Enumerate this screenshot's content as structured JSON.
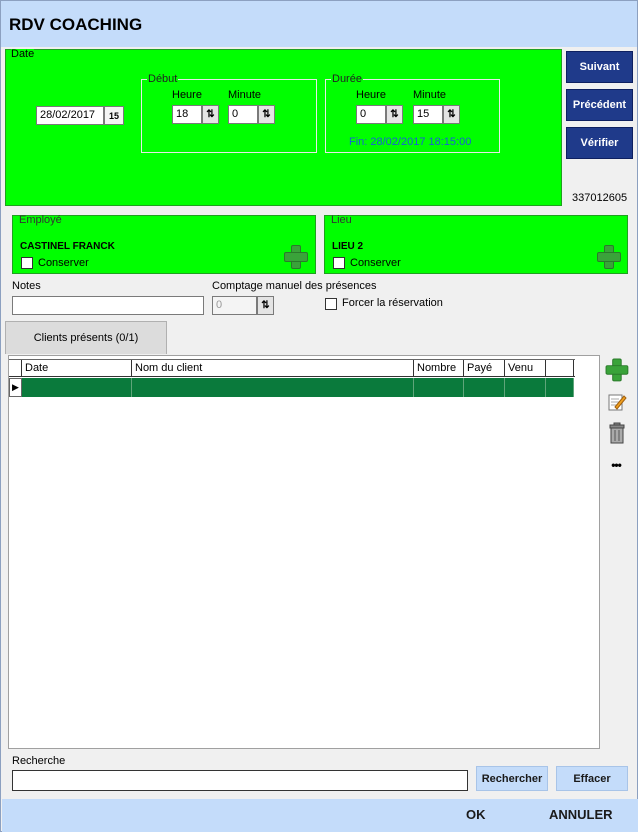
{
  "window": {
    "title": "RDV COACHING"
  },
  "date_panel": {
    "legend": "Date",
    "date_value": "28/02/2017",
    "calendar_icon_text": "15",
    "debut": {
      "legend": "Début",
      "heure_label": "Heure",
      "heure_value": "18",
      "minute_label": "Minute",
      "minute_value": "0"
    },
    "duree": {
      "legend": "Durée",
      "heure_label": "Heure",
      "heure_value": "0",
      "minute_label": "Minute",
      "minute_value": "15"
    },
    "fin_text": "Fin: 28/02/2017 18:15:00",
    "fin_color": "#1a5fd6"
  },
  "side_buttons": {
    "next": "Suivant",
    "previous": "Précédent",
    "verify": "Vérifier",
    "id_number": "337012605"
  },
  "employe": {
    "legend": "Employé",
    "name": "CASTINEL FRANCK",
    "conserver_label": "Conserver"
  },
  "lieu": {
    "legend": "Lieu",
    "name": "LIEU 2",
    "conserver_label": "Conserver"
  },
  "notes": {
    "label": "Notes",
    "value": ""
  },
  "comptage": {
    "label": "Comptage manuel des présences",
    "value": "0"
  },
  "forcer": {
    "label": "Forcer la réservation"
  },
  "tab": {
    "label": "Clients présents (0/1)"
  },
  "grid": {
    "columns": [
      "Date",
      "Nom du client",
      "Nombre",
      "Payé",
      "Venu"
    ],
    "row_marker": "▶"
  },
  "icons": {
    "add": "plus-icon",
    "edit": "edit-icon",
    "delete": "trash-icon",
    "more": "more-icon",
    "more_glyph": "•••"
  },
  "search": {
    "label": "Recherche",
    "value": "",
    "search_button": "Rechercher",
    "clear_button": "Effacer"
  },
  "footer": {
    "ok": "OK",
    "cancel": "ANNULER"
  },
  "colors": {
    "green_panel": "#00ff00",
    "title_bar": "#c4dcfa",
    "button_blue": "#1f3a8a",
    "row_selected": "#0a7a3c"
  }
}
